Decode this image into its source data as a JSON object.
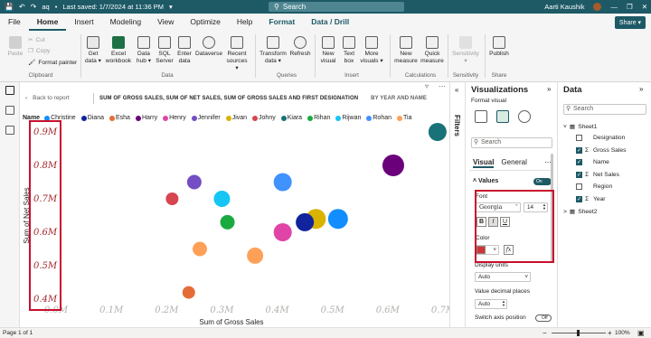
{
  "titlebar": {
    "file_name": "aq",
    "saved_text": "Last saved: 1/7/2024 at 11:36 PM",
    "search_placeholder": "Search",
    "user_name": "Aarti Kaushik"
  },
  "menu": {
    "items": [
      "File",
      "Home",
      "Insert",
      "Modeling",
      "View",
      "Optimize",
      "Help",
      "Format",
      "Data / Drill"
    ],
    "share_label": "Share"
  },
  "ribbon": {
    "clipboard": {
      "paste": "Paste",
      "cut": "Cut",
      "copy": "Copy",
      "format_painter": "Format painter",
      "group": "Clipboard"
    },
    "data": {
      "get_data": [
        "Get",
        "data"
      ],
      "excel": [
        "Excel",
        "workbook"
      ],
      "data_hub": [
        "Data",
        "hub"
      ],
      "sql": [
        "SQL",
        "Server"
      ],
      "enter_data": [
        "Enter",
        "data"
      ],
      "dataverse": [
        "Dataverse"
      ],
      "recent": [
        "Recent",
        "sources"
      ],
      "group": "Data"
    },
    "queries": {
      "transform": [
        "Transform",
        "data"
      ],
      "refresh": [
        "Refresh"
      ],
      "group": "Queries"
    },
    "insert": {
      "new_visual": [
        "New",
        "visual"
      ],
      "text_box": [
        "Text",
        "box"
      ],
      "more_visuals": [
        "More",
        "visuals"
      ],
      "group": "Insert"
    },
    "calculations": {
      "new_measure": [
        "New",
        "measure"
      ],
      "quick_measure": [
        "Quick",
        "measure"
      ],
      "group": "Calculations"
    },
    "sensitivity": {
      "label": "Sensitivity",
      "group": "Sensitivity"
    },
    "share": {
      "publish": "Publish",
      "group": "Share"
    }
  },
  "canvas": {
    "back_label": "Back to report",
    "visual_title": "SUM OF GROSS SALES, SUM OF NET SALES, SUM OF GROSS SALES AND FIRST DESIGNATION",
    "visual_by": "BY YEAR AND NAME"
  },
  "chart_data": {
    "type": "scatter",
    "legend_title": "Name",
    "legend": [
      {
        "name": "Christine",
        "color": "#118DFF"
      },
      {
        "name": "Diana",
        "color": "#12239E"
      },
      {
        "name": "Esha",
        "color": "#E66C37"
      },
      {
        "name": "Harry",
        "color": "#6B007B"
      },
      {
        "name": "Henry",
        "color": "#E044A7"
      },
      {
        "name": "Jennifer",
        "color": "#744EC2"
      },
      {
        "name": "Jivan",
        "color": "#D9B300"
      },
      {
        "name": "Johny",
        "color": "#D64550"
      },
      {
        "name": "Kiara",
        "color": "#197278"
      },
      {
        "name": "Rihan",
        "color": "#1AAB40"
      },
      {
        "name": "Rijwan",
        "color": "#15C6F4"
      },
      {
        "name": "Rohan",
        "color": "#4092FF"
      },
      {
        "name": "Tia",
        "color": "#FFA058"
      }
    ],
    "xlabel": "Sum of Gross Sales",
    "ylabel": "Sum of Net Sales",
    "xlim": [
      0,
      0.7
    ],
    "ylim": [
      0.4,
      0.9
    ],
    "x_ticks": [
      "0.0M",
      "0.1M",
      "0.2M",
      "0.3M",
      "0.4M",
      "0.5M",
      "0.6M",
      "0.7M"
    ],
    "y_ticks": [
      "0.4M",
      "0.5M",
      "0.6M",
      "0.7M",
      "0.8M",
      "0.9M"
    ],
    "points": [
      {
        "x": 0.21,
        "y": 0.7,
        "size": 7,
        "color": "#D64550"
      },
      {
        "x": 0.25,
        "y": 0.75,
        "size": 8,
        "color": "#744EC2"
      },
      {
        "x": 0.3,
        "y": 0.7,
        "size": 9,
        "color": "#15C6F4"
      },
      {
        "x": 0.31,
        "y": 0.63,
        "size": 8,
        "color": "#1AAB40"
      },
      {
        "x": 0.26,
        "y": 0.55,
        "size": 8,
        "color": "#FFA058"
      },
      {
        "x": 0.24,
        "y": 0.42,
        "size": 7,
        "color": "#E66C37"
      },
      {
        "x": 0.36,
        "y": 0.53,
        "size": 9,
        "color": "#FFA058"
      },
      {
        "x": 0.41,
        "y": 0.75,
        "size": 10,
        "color": "#4092FF"
      },
      {
        "x": 0.41,
        "y": 0.6,
        "size": 10,
        "color": "#E044A7"
      },
      {
        "x": 0.47,
        "y": 0.64,
        "size": 11,
        "color": "#D9B300"
      },
      {
        "x": 0.45,
        "y": 0.63,
        "size": 10,
        "color": "#12239E"
      },
      {
        "x": 0.51,
        "y": 0.64,
        "size": 11,
        "color": "#118DFF"
      },
      {
        "x": 0.61,
        "y": 0.8,
        "size": 12,
        "color": "#6B007B"
      },
      {
        "x": 0.69,
        "y": 0.9,
        "size": 10,
        "color": "#197278"
      }
    ]
  },
  "filters_label": "Filters",
  "viz_pane": {
    "title": "Visualizations",
    "format_visual": "Format visual",
    "search_placeholder": "Search",
    "tabs": [
      "Visual",
      "General"
    ],
    "values_label": "Values",
    "toggle_label": "On",
    "font_label": "Font",
    "font_family": "Georgia",
    "font_size": "14",
    "bold": "B",
    "italic": "I",
    "underline": "U",
    "color_label": "Color",
    "color_value": "#D13438",
    "fx_label": "fx",
    "display_units_label": "Display units",
    "display_units_value": "Auto",
    "decimal_label": "Value decimal places",
    "decimal_value": "Auto",
    "switch_label": "Switch axis position",
    "switch_state": "Off"
  },
  "data_pane": {
    "title": "Data",
    "search_placeholder": "Search",
    "tables": [
      {
        "name": "Sheet1",
        "fields": [
          {
            "name": "Designation",
            "checked": false,
            "sigma": false
          },
          {
            "name": "Gross Sales",
            "checked": true,
            "sigma": true
          },
          {
            "name": "Name",
            "checked": true,
            "sigma": false
          },
          {
            "name": "Net Sales",
            "checked": true,
            "sigma": true
          },
          {
            "name": "Region",
            "checked": false,
            "sigma": false
          },
          {
            "name": "Year",
            "checked": true,
            "sigma": true
          }
        ]
      },
      {
        "name": "Sheet2",
        "fields": []
      }
    ]
  },
  "status": {
    "page": "Page 1 of 1",
    "zoom": "100%"
  }
}
